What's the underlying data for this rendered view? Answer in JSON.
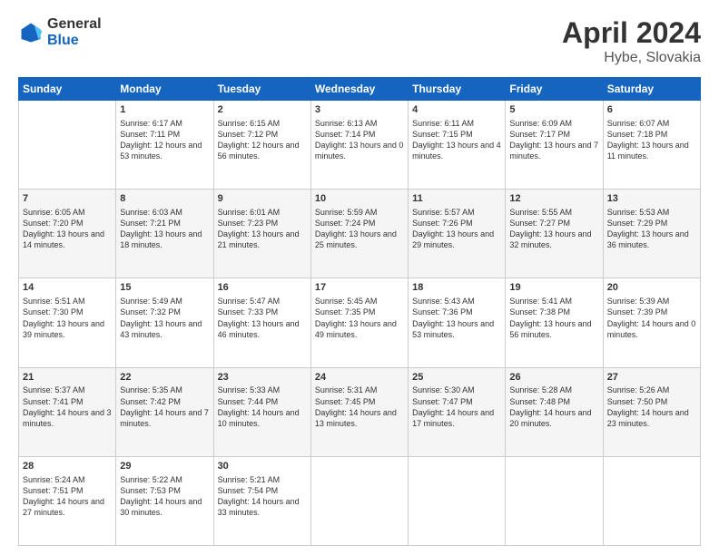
{
  "header": {
    "logo_general": "General",
    "logo_blue": "Blue",
    "title": "April 2024",
    "location": "Hybe, Slovakia"
  },
  "weekdays": [
    "Sunday",
    "Monday",
    "Tuesday",
    "Wednesday",
    "Thursday",
    "Friday",
    "Saturday"
  ],
  "weeks": [
    [
      {
        "day": "",
        "sunrise": "",
        "sunset": "",
        "daylight": ""
      },
      {
        "day": "1",
        "sunrise": "Sunrise: 6:17 AM",
        "sunset": "Sunset: 7:11 PM",
        "daylight": "Daylight: 12 hours and 53 minutes."
      },
      {
        "day": "2",
        "sunrise": "Sunrise: 6:15 AM",
        "sunset": "Sunset: 7:12 PM",
        "daylight": "Daylight: 12 hours and 56 minutes."
      },
      {
        "day": "3",
        "sunrise": "Sunrise: 6:13 AM",
        "sunset": "Sunset: 7:14 PM",
        "daylight": "Daylight: 13 hours and 0 minutes."
      },
      {
        "day": "4",
        "sunrise": "Sunrise: 6:11 AM",
        "sunset": "Sunset: 7:15 PM",
        "daylight": "Daylight: 13 hours and 4 minutes."
      },
      {
        "day": "5",
        "sunrise": "Sunrise: 6:09 AM",
        "sunset": "Sunset: 7:17 PM",
        "daylight": "Daylight: 13 hours and 7 minutes."
      },
      {
        "day": "6",
        "sunrise": "Sunrise: 6:07 AM",
        "sunset": "Sunset: 7:18 PM",
        "daylight": "Daylight: 13 hours and 11 minutes."
      }
    ],
    [
      {
        "day": "7",
        "sunrise": "Sunrise: 6:05 AM",
        "sunset": "Sunset: 7:20 PM",
        "daylight": "Daylight: 13 hours and 14 minutes."
      },
      {
        "day": "8",
        "sunrise": "Sunrise: 6:03 AM",
        "sunset": "Sunset: 7:21 PM",
        "daylight": "Daylight: 13 hours and 18 minutes."
      },
      {
        "day": "9",
        "sunrise": "Sunrise: 6:01 AM",
        "sunset": "Sunset: 7:23 PM",
        "daylight": "Daylight: 13 hours and 21 minutes."
      },
      {
        "day": "10",
        "sunrise": "Sunrise: 5:59 AM",
        "sunset": "Sunset: 7:24 PM",
        "daylight": "Daylight: 13 hours and 25 minutes."
      },
      {
        "day": "11",
        "sunrise": "Sunrise: 5:57 AM",
        "sunset": "Sunset: 7:26 PM",
        "daylight": "Daylight: 13 hours and 29 minutes."
      },
      {
        "day": "12",
        "sunrise": "Sunrise: 5:55 AM",
        "sunset": "Sunset: 7:27 PM",
        "daylight": "Daylight: 13 hours and 32 minutes."
      },
      {
        "day": "13",
        "sunrise": "Sunrise: 5:53 AM",
        "sunset": "Sunset: 7:29 PM",
        "daylight": "Daylight: 13 hours and 36 minutes."
      }
    ],
    [
      {
        "day": "14",
        "sunrise": "Sunrise: 5:51 AM",
        "sunset": "Sunset: 7:30 PM",
        "daylight": "Daylight: 13 hours and 39 minutes."
      },
      {
        "day": "15",
        "sunrise": "Sunrise: 5:49 AM",
        "sunset": "Sunset: 7:32 PM",
        "daylight": "Daylight: 13 hours and 43 minutes."
      },
      {
        "day": "16",
        "sunrise": "Sunrise: 5:47 AM",
        "sunset": "Sunset: 7:33 PM",
        "daylight": "Daylight: 13 hours and 46 minutes."
      },
      {
        "day": "17",
        "sunrise": "Sunrise: 5:45 AM",
        "sunset": "Sunset: 7:35 PM",
        "daylight": "Daylight: 13 hours and 49 minutes."
      },
      {
        "day": "18",
        "sunrise": "Sunrise: 5:43 AM",
        "sunset": "Sunset: 7:36 PM",
        "daylight": "Daylight: 13 hours and 53 minutes."
      },
      {
        "day": "19",
        "sunrise": "Sunrise: 5:41 AM",
        "sunset": "Sunset: 7:38 PM",
        "daylight": "Daylight: 13 hours and 56 minutes."
      },
      {
        "day": "20",
        "sunrise": "Sunrise: 5:39 AM",
        "sunset": "Sunset: 7:39 PM",
        "daylight": "Daylight: 14 hours and 0 minutes."
      }
    ],
    [
      {
        "day": "21",
        "sunrise": "Sunrise: 5:37 AM",
        "sunset": "Sunset: 7:41 PM",
        "daylight": "Daylight: 14 hours and 3 minutes."
      },
      {
        "day": "22",
        "sunrise": "Sunrise: 5:35 AM",
        "sunset": "Sunset: 7:42 PM",
        "daylight": "Daylight: 14 hours and 7 minutes."
      },
      {
        "day": "23",
        "sunrise": "Sunrise: 5:33 AM",
        "sunset": "Sunset: 7:44 PM",
        "daylight": "Daylight: 14 hours and 10 minutes."
      },
      {
        "day": "24",
        "sunrise": "Sunrise: 5:31 AM",
        "sunset": "Sunset: 7:45 PM",
        "daylight": "Daylight: 14 hours and 13 minutes."
      },
      {
        "day": "25",
        "sunrise": "Sunrise: 5:30 AM",
        "sunset": "Sunset: 7:47 PM",
        "daylight": "Daylight: 14 hours and 17 minutes."
      },
      {
        "day": "26",
        "sunrise": "Sunrise: 5:28 AM",
        "sunset": "Sunset: 7:48 PM",
        "daylight": "Daylight: 14 hours and 20 minutes."
      },
      {
        "day": "27",
        "sunrise": "Sunrise: 5:26 AM",
        "sunset": "Sunset: 7:50 PM",
        "daylight": "Daylight: 14 hours and 23 minutes."
      }
    ],
    [
      {
        "day": "28",
        "sunrise": "Sunrise: 5:24 AM",
        "sunset": "Sunset: 7:51 PM",
        "daylight": "Daylight: 14 hours and 27 minutes."
      },
      {
        "day": "29",
        "sunrise": "Sunrise: 5:22 AM",
        "sunset": "Sunset: 7:53 PM",
        "daylight": "Daylight: 14 hours and 30 minutes."
      },
      {
        "day": "30",
        "sunrise": "Sunrise: 5:21 AM",
        "sunset": "Sunset: 7:54 PM",
        "daylight": "Daylight: 14 hours and 33 minutes."
      },
      {
        "day": "",
        "sunrise": "",
        "sunset": "",
        "daylight": ""
      },
      {
        "day": "",
        "sunrise": "",
        "sunset": "",
        "daylight": ""
      },
      {
        "day": "",
        "sunrise": "",
        "sunset": "",
        "daylight": ""
      },
      {
        "day": "",
        "sunrise": "",
        "sunset": "",
        "daylight": ""
      }
    ]
  ]
}
